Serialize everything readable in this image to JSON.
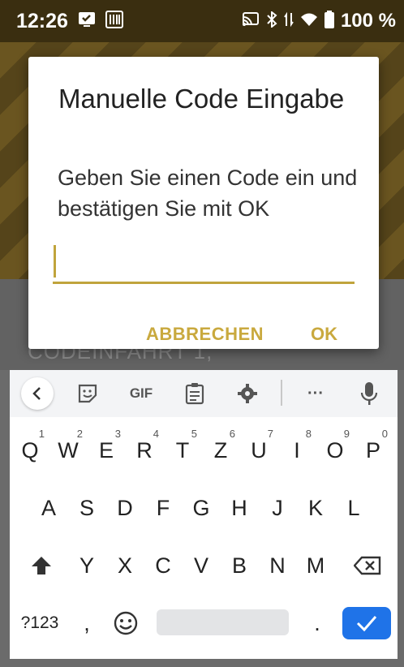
{
  "status_bar": {
    "time": "12:26",
    "battery": "100 %"
  },
  "background_app": {
    "body_text": "CODEINFAHRT 1,"
  },
  "dialog": {
    "title": "Manuelle Code Eingabe",
    "message": "Geben Sie einen Code ein und bestätigen Sie mit OK",
    "input_value": "",
    "cancel_label": "ABBRECHEN",
    "ok_label": "OK",
    "accent_color": "#c9a93e"
  },
  "keyboard": {
    "toolbar": [
      "back-icon",
      "sticker-icon",
      "GIF",
      "clipboard-icon",
      "gear-icon",
      "more-icon",
      "mic-icon"
    ],
    "gif_label": "GIF",
    "more_label": "···",
    "row1": [
      {
        "k": "Q",
        "h": "1"
      },
      {
        "k": "W",
        "h": "2"
      },
      {
        "k": "E",
        "h": "3"
      },
      {
        "k": "R",
        "h": "4"
      },
      {
        "k": "T",
        "h": "5"
      },
      {
        "k": "Z",
        "h": "6"
      },
      {
        "k": "U",
        "h": "7"
      },
      {
        "k": "I",
        "h": "8"
      },
      {
        "k": "O",
        "h": "9"
      },
      {
        "k": "P",
        "h": "0"
      }
    ],
    "row2": [
      "A",
      "S",
      "D",
      "F",
      "G",
      "H",
      "J",
      "K",
      "L"
    ],
    "row3": [
      "Y",
      "X",
      "C",
      "V",
      "B",
      "N",
      "M"
    ],
    "symbols_label": "?123",
    "comma_label": ",",
    "period_label": ".",
    "enter_color": "#1f73e8"
  }
}
